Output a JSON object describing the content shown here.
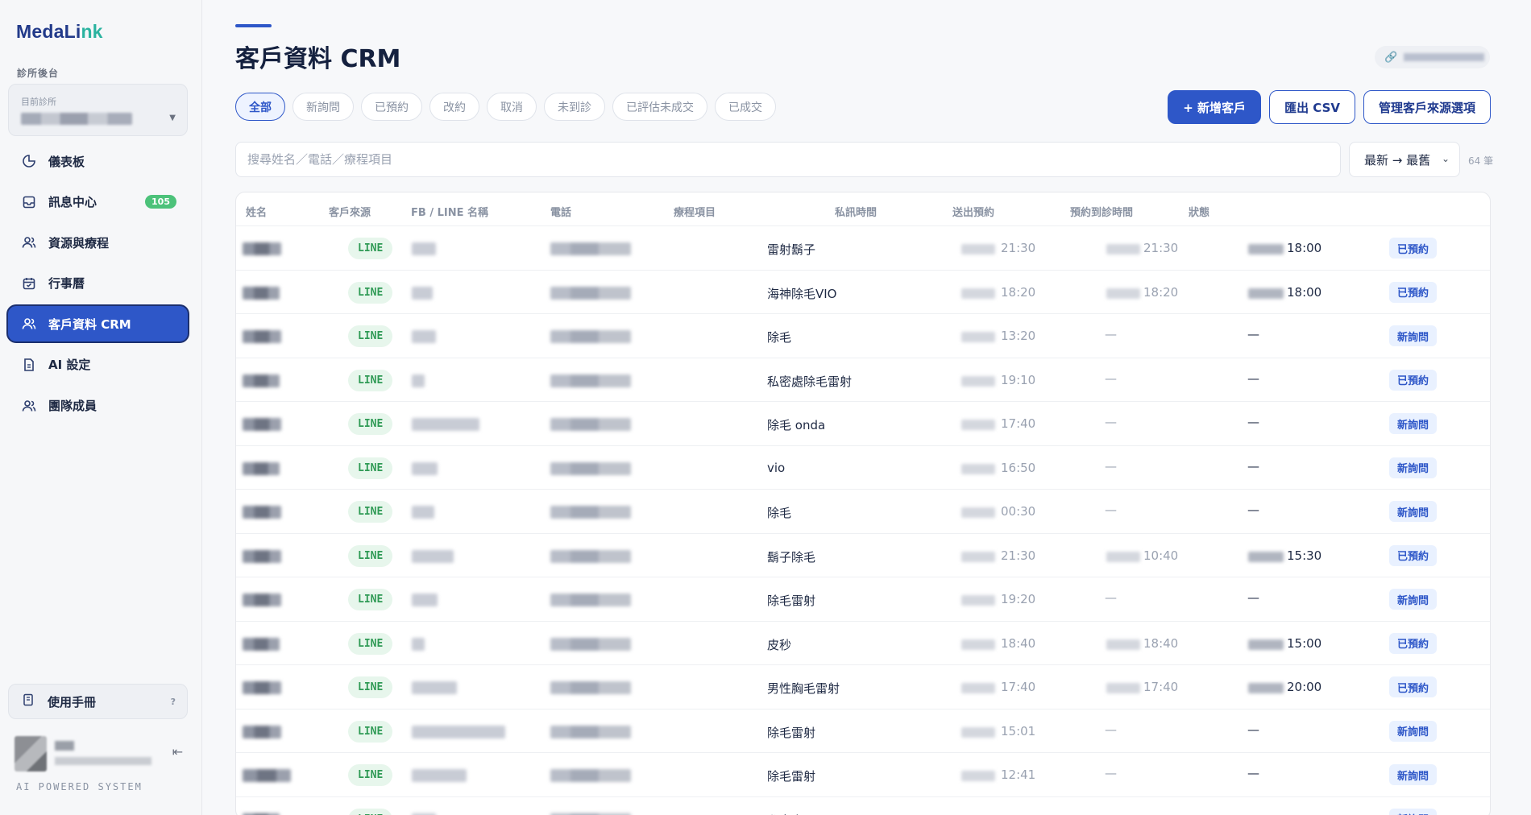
{
  "sidebar": {
    "logo_main": "MedaLi",
    "logo_accent": "nk",
    "section_label": "診所後台",
    "clinic_label": "目前診所",
    "nav": [
      {
        "label": "儀表板",
        "icon": "dashboard-icon"
      },
      {
        "label": "訊息中心",
        "icon": "inbox-icon",
        "badge": "105"
      },
      {
        "label": "資源與療程",
        "icon": "users-icon"
      },
      {
        "label": "行事曆",
        "icon": "calendar-icon"
      },
      {
        "label": "客戶資料 CRM",
        "icon": "users-icon",
        "active": true
      },
      {
        "label": "AI 設定",
        "icon": "document-icon"
      },
      {
        "label": "團隊成員",
        "icon": "users-icon"
      }
    ],
    "manual_label": "使用手冊",
    "manual_hint": "?",
    "powered_by": "AI POWERED SYSTEM"
  },
  "header": {
    "title": "客戶資料 CRM"
  },
  "filters": [
    "全部",
    "新詢問",
    "已預約",
    "改約",
    "取消",
    "未到診",
    "已評估未成交",
    "已成交"
  ],
  "actions": {
    "add": "+ 新增客戶",
    "export": "匯出 CSV",
    "manage": "管理客戶來源選項"
  },
  "search": {
    "placeholder": "搜尋姓名／電話／療程項目"
  },
  "sort": {
    "value": "最新 → 最舊"
  },
  "count": "64 筆",
  "table": {
    "columns": [
      "姓名",
      "客戶來源",
      "FB / LINE 名稱",
      "電話",
      "療程項目",
      "私訊時間",
      "送出預約",
      "預約到診時間",
      "狀態"
    ],
    "rows": [
      {
        "source": "LINE",
        "treatment": "雷射鬍子",
        "msg_time": "21:30",
        "booking": "21:30",
        "visit": "18:00",
        "status": "已預約"
      },
      {
        "source": "LINE",
        "treatment": "海神除毛VIO",
        "msg_time": "18:20",
        "booking": "18:20",
        "visit": "18:00",
        "status": "已預約"
      },
      {
        "source": "LINE",
        "treatment": "除毛",
        "msg_time": "13:20",
        "booking": "—",
        "visit": "—",
        "status": "新詢問"
      },
      {
        "source": "LINE",
        "treatment": "私密處除毛雷射",
        "msg_time": "19:10",
        "booking": "—",
        "visit": "—",
        "status": "已預約"
      },
      {
        "source": "LINE",
        "treatment": "除毛 onda",
        "msg_time": "17:40",
        "booking": "—",
        "visit": "—",
        "status": "新詢問"
      },
      {
        "source": "LINE",
        "treatment": "vio",
        "msg_time": "16:50",
        "booking": "—",
        "visit": "—",
        "status": "新詢問"
      },
      {
        "source": "LINE",
        "treatment": "除毛",
        "msg_time": "00:30",
        "booking": "—",
        "visit": "—",
        "status": "新詢問"
      },
      {
        "source": "LINE",
        "treatment": "鬍子除毛",
        "msg_time": "21:30",
        "booking": "10:40",
        "visit": "15:30",
        "status": "已預約"
      },
      {
        "source": "LINE",
        "treatment": "除毛雷射",
        "msg_time": "19:20",
        "booking": "—",
        "visit": "—",
        "status": "新詢問"
      },
      {
        "source": "LINE",
        "treatment": "皮秒",
        "msg_time": "18:40",
        "booking": "18:40",
        "visit": "15:00",
        "status": "已預約"
      },
      {
        "source": "LINE",
        "treatment": "男性胸毛雷射",
        "msg_time": "17:40",
        "booking": "17:40",
        "visit": "20:00",
        "status": "已預約"
      },
      {
        "source": "LINE",
        "treatment": "除毛雷射",
        "msg_time": "15:01",
        "booking": "—",
        "visit": "—",
        "status": "新詢問"
      },
      {
        "source": "LINE",
        "treatment": "除毛雷射",
        "msg_time": "12:41",
        "booking": "—",
        "visit": "—",
        "status": "新詢問"
      },
      {
        "source": "LINE",
        "treatment": "私密處",
        "msg_time": "",
        "booking": "",
        "visit": "",
        "status": "新詢問"
      }
    ]
  }
}
